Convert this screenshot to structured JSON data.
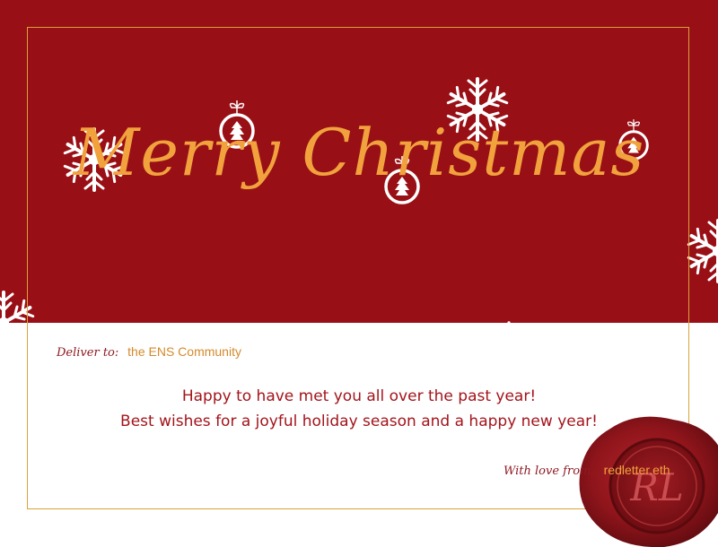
{
  "card": {
    "title": "Merry Christmas",
    "deliver_label": "Deliver to:",
    "deliver_to": "the ENS Community",
    "message_line_1": "Happy to have met you all over the past year!",
    "message_line_2": "Best wishes for a joyful holiday season and a happy new year!",
    "signoff_label": "With love from:",
    "signoff_name": "redletter.eth",
    "seal_monogram": "RL"
  },
  "colors": {
    "background_red": "#990f16",
    "gold": "#f1a23d",
    "text_red": "#a3141b",
    "white": "#ffffff",
    "wax": "#8f151b"
  }
}
